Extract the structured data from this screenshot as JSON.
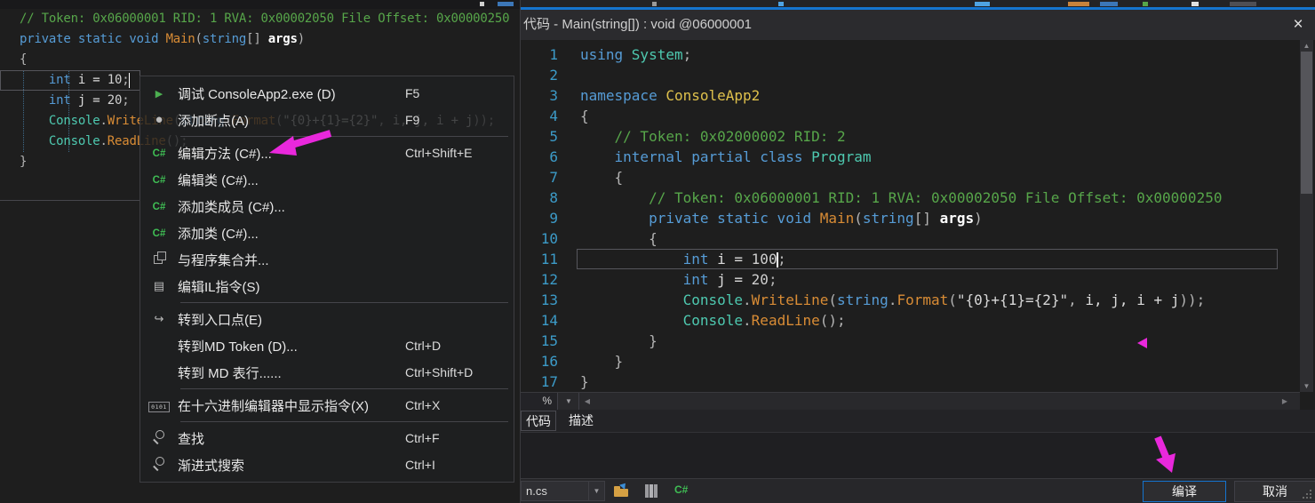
{
  "colors": {
    "accent_blue": "#1574CF",
    "annotation_magenta": "#E928DC"
  },
  "left_pane": {
    "code": {
      "lines": [
        {
          "segs": [
            [
              "cm",
              "// Token: 0x06000001 RID: 1 RVA: 0x00002050 File Offset: 0x00000250"
            ]
          ]
        },
        {
          "segs": [
            [
              "kw",
              "private static void "
            ],
            [
              "mt",
              "Main"
            ],
            [
              "pu",
              "("
            ],
            [
              "kw",
              "string"
            ],
            [
              "pu",
              "[] "
            ],
            [
              "ar",
              "args"
            ],
            [
              "pu",
              ")"
            ]
          ]
        },
        {
          "segs": [
            [
              "pu",
              "{"
            ]
          ]
        },
        {
          "segs": [
            [
              "kw",
              "    int"
            ],
            [
              "pl",
              " i = "
            ],
            [
              "nu",
              "10"
            ],
            [
              "pu",
              ";"
            ],
            [
              "caret",
              ""
            ]
          ]
        },
        {
          "segs": [
            [
              "kw",
              "    int"
            ],
            [
              "pl",
              " j = "
            ],
            [
              "nu",
              "20"
            ],
            [
              "pu",
              ";"
            ]
          ]
        },
        {
          "segs": [
            [
              "ty",
              "    Console"
            ],
            [
              "pu",
              "."
            ],
            [
              "mt",
              "WriteLine"
            ],
            [
              "pu",
              "("
            ],
            [
              "kw",
              "string"
            ],
            [
              "pu",
              "."
            ],
            [
              "mt",
              "Format"
            ],
            [
              "pu",
              "("
            ],
            [
              "st",
              "\"{0}+{1}={2}\""
            ],
            [
              "pu",
              ", "
            ],
            [
              "pl",
              "i, j, i + j"
            ],
            [
              "pu",
              "));"
            ]
          ]
        },
        {
          "segs": [
            [
              "ty",
              "    Console"
            ],
            [
              "pu",
              "."
            ],
            [
              "mt",
              "ReadLine"
            ],
            [
              "pu",
              "();"
            ]
          ]
        },
        {
          "segs": [
            [
              "pu",
              "}"
            ]
          ]
        }
      ]
    },
    "menu": {
      "items": [
        {
          "icon": "play",
          "label": "调试 ConsoleApp2.exe (D)",
          "shortcut": "F5"
        },
        {
          "icon": "breakpoint",
          "label": "添加断点(A)",
          "shortcut": "F9"
        },
        {
          "type": "separator"
        },
        {
          "icon": "csharp",
          "label": "编辑方法 (C#)...",
          "shortcut": "Ctrl+Shift+E"
        },
        {
          "icon": "csharp",
          "label": "编辑类 (C#)..."
        },
        {
          "icon": "csharp",
          "label": "添加类成员 (C#)..."
        },
        {
          "icon": "csharp",
          "label": "添加类 (C#)..."
        },
        {
          "icon": "merge",
          "label": "与程序集合并..."
        },
        {
          "icon": "il",
          "label": "编辑IL指令(S)"
        },
        {
          "type": "separator"
        },
        {
          "icon": "entry",
          "label": "转到入口点(E)"
        },
        {
          "icon": null,
          "label": "转到MD Token (D)...",
          "shortcut": "Ctrl+D"
        },
        {
          "icon": null,
          "label": "转到 MD 表行......",
          "shortcut": "Ctrl+Shift+D"
        },
        {
          "type": "separator"
        },
        {
          "icon": "hex",
          "label": "在十六进制编辑器中显示指令(X)",
          "shortcut": "Ctrl+X"
        },
        {
          "type": "separator"
        },
        {
          "icon": "search",
          "label": "查找",
          "shortcut": "Ctrl+F"
        },
        {
          "icon": "search",
          "label": "渐进式搜索",
          "shortcut": "Ctrl+I"
        }
      ]
    }
  },
  "dialog": {
    "title": "代码 - Main(string[]) : void @06000001",
    "close_label": "×",
    "zoom_percent_label": "%",
    "tabs": [
      {
        "label": "代码"
      },
      {
        "label": "描述"
      }
    ],
    "file_select": "n.cs",
    "compile_button": "编译",
    "cancel_button": "取消",
    "code": {
      "lines": [
        {
          "n": 1,
          "segs": [
            [
              "kw",
              "using "
            ],
            [
              "ty",
              "System"
            ],
            [
              "pu",
              ";"
            ]
          ]
        },
        {
          "n": 2,
          "segs": []
        },
        {
          "n": 3,
          "segs": [
            [
              "kw",
              "namespace "
            ],
            [
              "ns",
              "ConsoleApp2"
            ]
          ]
        },
        {
          "n": 4,
          "segs": [
            [
              "pu",
              "{"
            ]
          ]
        },
        {
          "n": 5,
          "segs": [
            [
              "cm",
              "    // Token: 0x02000002 RID: 2"
            ]
          ]
        },
        {
          "n": 6,
          "segs": [
            [
              "kw",
              "    internal partial class "
            ],
            [
              "ty",
              "Program"
            ]
          ]
        },
        {
          "n": 7,
          "segs": [
            [
              "pu",
              "    {"
            ]
          ]
        },
        {
          "n": 8,
          "segs": [
            [
              "cm",
              "        // Token: 0x06000001 RID: 1 RVA: 0x00002050 File Offset: 0x00000250"
            ]
          ]
        },
        {
          "n": 9,
          "segs": [
            [
              "kw",
              "        private static void "
            ],
            [
              "mt",
              "Main"
            ],
            [
              "pu",
              "("
            ],
            [
              "kw",
              "string"
            ],
            [
              "pu",
              "[] "
            ],
            [
              "ar",
              "args"
            ],
            [
              "pu",
              ")"
            ]
          ]
        },
        {
          "n": 10,
          "segs": [
            [
              "pu",
              "        {"
            ]
          ]
        },
        {
          "n": 11,
          "current": true,
          "segs": [
            [
              "kw",
              "            int"
            ],
            [
              "pl",
              " i = "
            ],
            [
              "nu",
              "100"
            ],
            [
              "caret",
              ""
            ],
            [
              "pu",
              ";"
            ]
          ]
        },
        {
          "n": 12,
          "segs": [
            [
              "kw",
              "            int"
            ],
            [
              "pl",
              " j = "
            ],
            [
              "nu",
              "20"
            ],
            [
              "pu",
              ";"
            ]
          ]
        },
        {
          "n": 13,
          "segs": [
            [
              "ty",
              "            Console"
            ],
            [
              "pu",
              "."
            ],
            [
              "mt",
              "WriteLine"
            ],
            [
              "pu",
              "("
            ],
            [
              "kw",
              "string"
            ],
            [
              "pu",
              "."
            ],
            [
              "mt",
              "Format"
            ],
            [
              "pu",
              "("
            ],
            [
              "st",
              "\"{0}+{1}={2}\""
            ],
            [
              "pu",
              ", "
            ],
            [
              "pl",
              "i, j, i + j"
            ],
            [
              "pu",
              "));"
            ]
          ]
        },
        {
          "n": 14,
          "segs": [
            [
              "ty",
              "            Console"
            ],
            [
              "pu",
              "."
            ],
            [
              "mt",
              "ReadLine"
            ],
            [
              "pu",
              "();"
            ]
          ]
        },
        {
          "n": 15,
          "segs": [
            [
              "pu",
              "        }"
            ]
          ]
        },
        {
          "n": 16,
          "segs": [
            [
              "pu",
              "    }"
            ]
          ]
        },
        {
          "n": 17,
          "segs": [
            [
              "pu",
              "}"
            ]
          ]
        }
      ]
    }
  }
}
